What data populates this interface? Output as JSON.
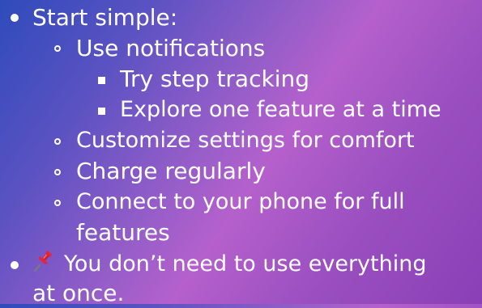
{
  "bullets": {
    "start_simple": "Start simple:",
    "use_notifications": "Use notifications",
    "try_step_tracking": "Try step tracking",
    "explore_one_feature": "Explore one feature at a time",
    "customize_settings": "Customize settings for comfort",
    "charge_regularly": "Charge regularly",
    "connect_phone_line1": "Connect to your phone for full",
    "connect_phone_line2": "features",
    "dont_need_line1": "You don’t need to use everything",
    "dont_need_line2": "at once."
  },
  "icons": {
    "pin": "pushpin-icon"
  },
  "colors": {
    "text": "#ffffff",
    "gradient_start": "#2f4bbb",
    "gradient_mid": "#b560cc",
    "gradient_end": "#8a3fb6"
  }
}
